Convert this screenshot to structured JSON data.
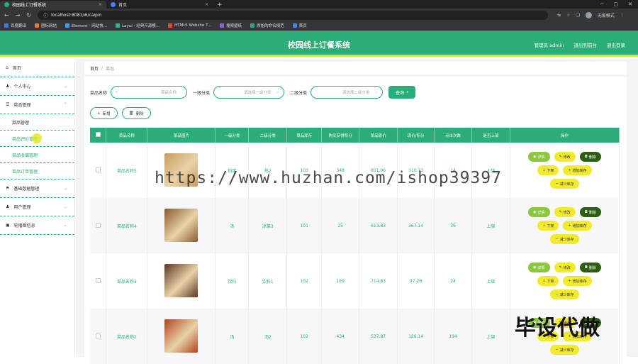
{
  "browser": {
    "tabs": [
      {
        "label": "校园线上订餐系统",
        "active": true,
        "color": "#2aad78"
      },
      {
        "label": "首页",
        "active": false,
        "color": "#4285f4"
      }
    ],
    "url": "localhost:8081/#/caipin",
    "incognito": "无痕模式",
    "bookmarks": [
      {
        "label": "百度翻译",
        "color": "#3b7ddd"
      },
      {
        "label": "图标网站",
        "color": "#ee7b2c"
      },
      {
        "label": "Element - 网站快...",
        "color": "#409eff"
      },
      {
        "label": "Layui - 经典开源模...",
        "color": "#2bbd8b"
      },
      {
        "label": "HTML5 Website T...",
        "color": "#e14f2e"
      },
      {
        "label": "搜索壁纸",
        "color": "#8a63d2"
      },
      {
        "label": "原始的命名规范",
        "color": "#2aad78"
      },
      {
        "label": "首页",
        "color": "#4285f4"
      }
    ]
  },
  "header": {
    "title": "校园线上订餐系统",
    "user": "管理员 admin",
    "front": "退出到前台",
    "logout": "退出登录"
  },
  "sidebar": {
    "items": [
      {
        "label": "首页",
        "icon": "home-icon"
      },
      {
        "label": "个人中心",
        "icon": "user-icon"
      },
      {
        "label": "菜品管理",
        "icon": "menu-icon"
      }
    ],
    "subs": [
      "菜品管理",
      "菜品评价管理",
      "菜品收藏管理",
      "菜品订单管理"
    ],
    "items2": [
      {
        "label": "基础数据管理",
        "icon": "flag-icon"
      },
      {
        "label": "用户管理",
        "icon": "user-icon"
      },
      {
        "label": "轮播图信息",
        "icon": "image-icon"
      }
    ]
  },
  "breadcrumb": {
    "home": "首页",
    "sep": "/",
    "current": "菜品"
  },
  "filter": {
    "name_label": "菜品名称",
    "name_placeholder": "菜品名称",
    "type1_label": "一级分类",
    "type1_placeholder": "请选择一级分类",
    "type2_label": "二级分类",
    "type2_placeholder": "请选择二级分类",
    "query": "查询"
  },
  "actions": {
    "add": "新增",
    "delete": "删除"
  },
  "table": {
    "headers": [
      "菜品名称",
      "菜品图片",
      "一级分类",
      "二级分类",
      "菜品库存",
      "购买获得积分",
      "菜品原价",
      "现价/积分",
      "点击次数",
      "是否上架",
      "操作"
    ],
    "rows": [
      {
        "name": "菜品名称5",
        "img": "#c89a5e",
        "t1": "热菜",
        "t2": "热2",
        "stock": "103",
        "points": "348",
        "orig": "851.06",
        "now": "310.73",
        "clicks": "14",
        "status": "上架"
      },
      {
        "name": "菜品名称4",
        "img": "#8a5a2c",
        "t1": "汤",
        "t2": "凉菜3",
        "stock": "101",
        "points": "25",
        "orig": "613.83",
        "now": "367.14",
        "clicks": "36",
        "status": "上架"
      },
      {
        "name": "菜品名称3",
        "img": "#5a3520",
        "t1": "饮料",
        "t2": "饮料1",
        "stock": "102",
        "points": "169",
        "orig": "714.83",
        "now": "97.26",
        "clicks": "24",
        "status": "上架"
      },
      {
        "name": "菜品名称2",
        "img": "#b0431e",
        "t1": "汤",
        "t2": "汤2",
        "stock": "102",
        "points": "434",
        "orig": "537.87",
        "now": "126.14",
        "clicks": "194",
        "status": "上架"
      }
    ],
    "ops": {
      "detail": "详情",
      "edit": "修改",
      "del": "删除",
      "down": "下架",
      "add_stock": "增加库存",
      "reduce_stock": "减少库存"
    }
  },
  "watermark": {
    "url": "https://www.huzhan.com/ishop39397",
    "text": "毕设代做"
  }
}
